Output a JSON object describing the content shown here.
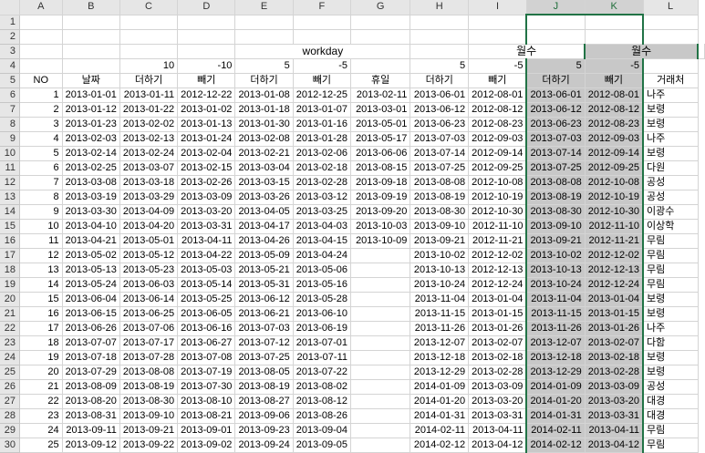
{
  "columns": [
    "A",
    "B",
    "C",
    "D",
    "E",
    "F",
    "G",
    "H",
    "I",
    "J",
    "K",
    "L"
  ],
  "row3": {
    "workday": "workday",
    "months_title_1": "월수",
    "months_title_2": "월수"
  },
  "row4": {
    "c10": "10",
    "d_neg10": "-10",
    "e5": "5",
    "f_neg5": "-5",
    "h5": "5",
    "i_neg5": "-5",
    "j5": "5",
    "k_neg5": "-5"
  },
  "headers": [
    "NO",
    "날짜",
    "더하기",
    "빼기",
    "더하기",
    "빼기",
    "휴일",
    "더하기",
    "빼기",
    "더하기",
    "빼기",
    "거래처"
  ],
  "rows": [
    [
      "1",
      "2013-01-01",
      "2013-01-11",
      "2012-12-22",
      "2013-01-08",
      "2012-12-25",
      "2013-02-11",
      "2013-06-01",
      "2012-08-01",
      "2013-06-01",
      "2012-08-01",
      "나주"
    ],
    [
      "2",
      "2013-01-12",
      "2013-01-22",
      "2013-01-02",
      "2013-01-18",
      "2013-01-07",
      "2013-03-01",
      "2013-06-12",
      "2012-08-12",
      "2013-06-12",
      "2012-08-12",
      "보령"
    ],
    [
      "3",
      "2013-01-23",
      "2013-02-02",
      "2013-01-13",
      "2013-01-30",
      "2013-01-16",
      "2013-05-01",
      "2013-06-23",
      "2012-08-23",
      "2013-06-23",
      "2012-08-23",
      "보령"
    ],
    [
      "4",
      "2013-02-03",
      "2013-02-13",
      "2013-01-24",
      "2013-02-08",
      "2013-01-28",
      "2013-05-17",
      "2013-07-03",
      "2012-09-03",
      "2013-07-03",
      "2012-09-03",
      "나주"
    ],
    [
      "5",
      "2013-02-14",
      "2013-02-24",
      "2013-02-04",
      "2013-02-21",
      "2013-02-06",
      "2013-06-06",
      "2013-07-14",
      "2012-09-14",
      "2013-07-14",
      "2012-09-14",
      "보령"
    ],
    [
      "6",
      "2013-02-25",
      "2013-03-07",
      "2013-02-15",
      "2013-03-04",
      "2013-02-18",
      "2013-08-15",
      "2013-07-25",
      "2012-09-25",
      "2013-07-25",
      "2012-09-25",
      "다원"
    ],
    [
      "7",
      "2013-03-08",
      "2013-03-18",
      "2013-02-26",
      "2013-03-15",
      "2013-02-28",
      "2013-09-18",
      "2013-08-08",
      "2012-10-08",
      "2013-08-08",
      "2012-10-08",
      "공성"
    ],
    [
      "8",
      "2013-03-19",
      "2013-03-29",
      "2013-03-09",
      "2013-03-26",
      "2013-03-12",
      "2013-09-19",
      "2013-08-19",
      "2012-10-19",
      "2013-08-19",
      "2012-10-19",
      "공성"
    ],
    [
      "9",
      "2013-03-30",
      "2013-04-09",
      "2013-03-20",
      "2013-04-05",
      "2013-03-25",
      "2013-09-20",
      "2013-08-30",
      "2012-10-30",
      "2013-08-30",
      "2012-10-30",
      "이광수"
    ],
    [
      "10",
      "2013-04-10",
      "2013-04-20",
      "2013-03-31",
      "2013-04-17",
      "2013-04-03",
      "2013-10-03",
      "2013-09-10",
      "2012-11-10",
      "2013-09-10",
      "2012-11-10",
      "이상학"
    ],
    [
      "11",
      "2013-04-21",
      "2013-05-01",
      "2013-04-11",
      "2013-04-26",
      "2013-04-15",
      "2013-10-09",
      "2013-09-21",
      "2012-11-21",
      "2013-09-21",
      "2012-11-21",
      "무림"
    ],
    [
      "12",
      "2013-05-02",
      "2013-05-12",
      "2013-04-22",
      "2013-05-09",
      "2013-04-24",
      "",
      "2013-10-02",
      "2012-12-02",
      "2013-10-02",
      "2012-12-02",
      "무림"
    ],
    [
      "13",
      "2013-05-13",
      "2013-05-23",
      "2013-05-03",
      "2013-05-21",
      "2013-05-06",
      "",
      "2013-10-13",
      "2012-12-13",
      "2013-10-13",
      "2012-12-13",
      "무림"
    ],
    [
      "14",
      "2013-05-24",
      "2013-06-03",
      "2013-05-14",
      "2013-05-31",
      "2013-05-16",
      "",
      "2013-10-24",
      "2012-12-24",
      "2013-10-24",
      "2012-12-24",
      "무림"
    ],
    [
      "15",
      "2013-06-04",
      "2013-06-14",
      "2013-05-25",
      "2013-06-12",
      "2013-05-28",
      "",
      "2013-11-04",
      "2013-01-04",
      "2013-11-04",
      "2013-01-04",
      "보령"
    ],
    [
      "16",
      "2013-06-15",
      "2013-06-25",
      "2013-06-05",
      "2013-06-21",
      "2013-06-10",
      "",
      "2013-11-15",
      "2013-01-15",
      "2013-11-15",
      "2013-01-15",
      "보령"
    ],
    [
      "17",
      "2013-06-26",
      "2013-07-06",
      "2013-06-16",
      "2013-07-03",
      "2013-06-19",
      "",
      "2013-11-26",
      "2013-01-26",
      "2013-11-26",
      "2013-01-26",
      "나주"
    ],
    [
      "18",
      "2013-07-07",
      "2013-07-17",
      "2013-06-27",
      "2013-07-12",
      "2013-07-01",
      "",
      "2013-12-07",
      "2013-02-07",
      "2013-12-07",
      "2013-02-07",
      "다함"
    ],
    [
      "19",
      "2013-07-18",
      "2013-07-28",
      "2013-07-08",
      "2013-07-25",
      "2013-07-11",
      "",
      "2013-12-18",
      "2013-02-18",
      "2013-12-18",
      "2013-02-18",
      "보령"
    ],
    [
      "20",
      "2013-07-29",
      "2013-08-08",
      "2013-07-19",
      "2013-08-05",
      "2013-07-22",
      "",
      "2013-12-29",
      "2013-02-28",
      "2013-12-29",
      "2013-02-28",
      "보령"
    ],
    [
      "21",
      "2013-08-09",
      "2013-08-19",
      "2013-07-30",
      "2013-08-19",
      "2013-08-02",
      "",
      "2014-01-09",
      "2013-03-09",
      "2014-01-09",
      "2013-03-09",
      "공성"
    ],
    [
      "22",
      "2013-08-20",
      "2013-08-30",
      "2013-08-10",
      "2013-08-27",
      "2013-08-12",
      "",
      "2014-01-20",
      "2013-03-20",
      "2014-01-20",
      "2013-03-20",
      "대경"
    ],
    [
      "23",
      "2013-08-31",
      "2013-09-10",
      "2013-08-21",
      "2013-09-06",
      "2013-08-26",
      "",
      "2014-01-31",
      "2013-03-31",
      "2014-01-31",
      "2013-03-31",
      "대경"
    ],
    [
      "24",
      "2013-09-11",
      "2013-09-21",
      "2013-09-01",
      "2013-09-23",
      "2013-09-04",
      "",
      "2014-02-11",
      "2013-04-11",
      "2014-02-11",
      "2013-04-11",
      "무림"
    ],
    [
      "25",
      "2013-09-12",
      "2013-09-22",
      "2013-09-02",
      "2013-09-24",
      "2013-09-05",
      "",
      "2014-02-12",
      "2013-04-12",
      "2014-02-12",
      "2013-04-12",
      "무림"
    ]
  ]
}
